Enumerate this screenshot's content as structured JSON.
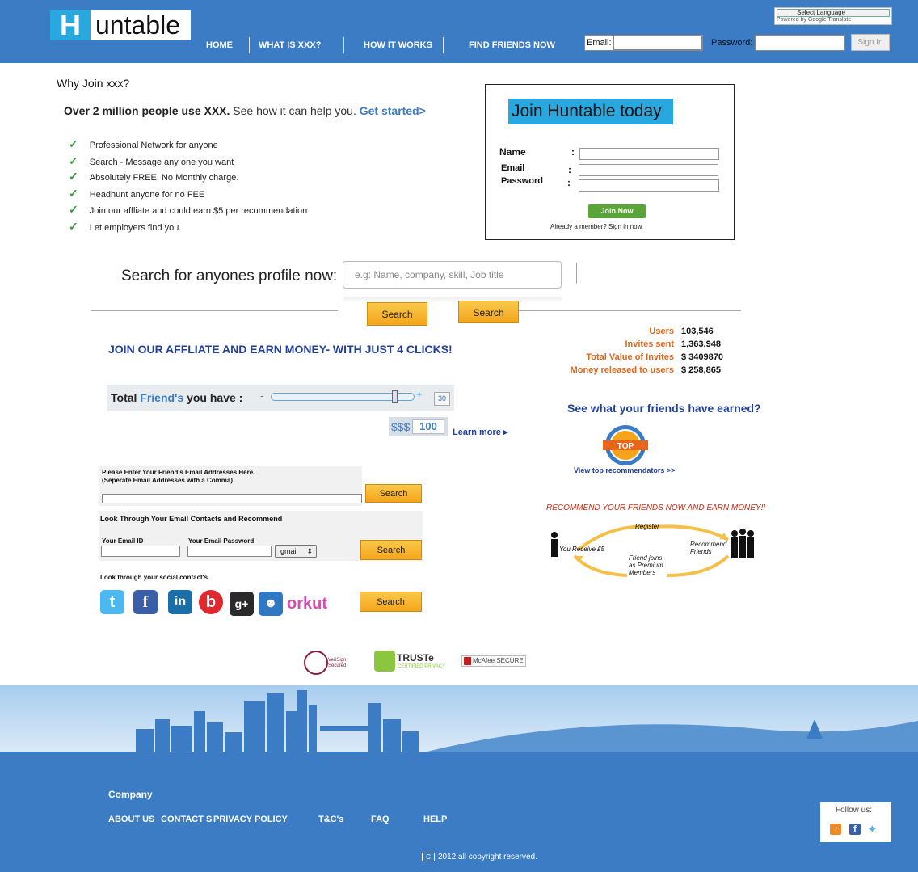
{
  "header": {
    "logo_letter": "H",
    "logo_text": "untable",
    "nav": [
      "HOME",
      "WHAT IS XXX?",
      "HOW IT WORKS",
      "FIND FRIENDS NOW"
    ],
    "language_select": "Select Language",
    "powered_by": "Powered by Google Translate",
    "email_label": "Email:",
    "password_label": "Password:",
    "sign_in": "Sign In"
  },
  "intro": {
    "why": "Why Join xxx?",
    "headline_bold": "Over 2 million people use XXX.",
    "headline_rest": " See how it can help you. ",
    "get_started": "Get started>",
    "features": [
      "Professional Network for anyone",
      "Search - Message any one you want",
      "Absolutely FREE. No Monthly charge.",
      "Headhunt anyone for no FEE",
      "Join our affliate and could earn $5 per recommendation",
      "Let employers find you."
    ]
  },
  "join": {
    "title": "Join Huntable today",
    "name_label": "Name",
    "email_label": "Email",
    "password_label": "Password",
    "colon": ":",
    "button": "Join Now",
    "already": "Already a member? Sign in now"
  },
  "search": {
    "label": "Search for anyones profile now:",
    "placeholder": "e.g: Name, company, skill, Job title",
    "button": "Search"
  },
  "affiliate": {
    "title": "JOIN OUR AFFLIATE AND EARN MONEY- WITH JUST 4 CLICKS!",
    "total_prefix": "Total ",
    "total_friends": "Friend's",
    "total_suffix": " you have :",
    "minus": "-",
    "plus": "+",
    "slider_level": 0.88,
    "friend_count": "30",
    "money_symbol": "$$$",
    "money_value": "100",
    "learn_more": "Learn more ▸"
  },
  "stats": [
    {
      "label": "Users",
      "value": "103,546"
    },
    {
      "label": "Invites sent",
      "value": "1,363,948"
    },
    {
      "label": "Total Value of Invites",
      "value": "$ 3409870"
    },
    {
      "label": "Money released to users",
      "value": "$ 258,865"
    }
  ],
  "friends": {
    "see_what": "See what your friends have earned?",
    "badge": "TOP",
    "view_top": "View top recommendators >>",
    "recommend": "RECOMMEND YOUR FRIENDS NOW AND EARN MONEY!!",
    "cycle": {
      "register": "Register",
      "recommend_friends": "Recommend Friends",
      "joins": "Friend joins as Premium Members",
      "receive": "You Receive £5"
    }
  },
  "email_forms": {
    "enter_heading": "Please Enter Your Friend's Email Addresses Here.",
    "enter_sub": "(Seperate Email Addresses with a Comma)",
    "look_heading": "Look Through Your Email Contacts and Recommend",
    "your_email_id": "Your Email ID",
    "your_email_password": "Your Email Password",
    "provider": "gmail",
    "social_heading": "Look through your social contact's",
    "search": "Search",
    "social": [
      "twitter",
      "facebook",
      "linkedin",
      "bebo",
      "google-plus",
      "myspace"
    ],
    "orkut": "orkut"
  },
  "trust": {
    "verisign": "VeriSign Secured",
    "truste": "TRUSTe",
    "truste_sub": "CERTIFIED PRIVACY",
    "mcafee": "McAfee SECURE"
  },
  "footer": {
    "company": "Company",
    "links": [
      "ABOUT US",
      "CONTACT S",
      "PRIVACY POLICY",
      "T&C's",
      "FAQ",
      "HELP"
    ],
    "follow": "Follow us:",
    "copyright": "2012 all copyright reserved.",
    "copy_symbol": "C"
  },
  "colors": {
    "brand_blue": "#3b7cc4",
    "accent_cyan": "#29a8e0",
    "orange_button": "#f4a51c",
    "stat_orange": "#e0661b",
    "navy_text": "#22409a"
  }
}
